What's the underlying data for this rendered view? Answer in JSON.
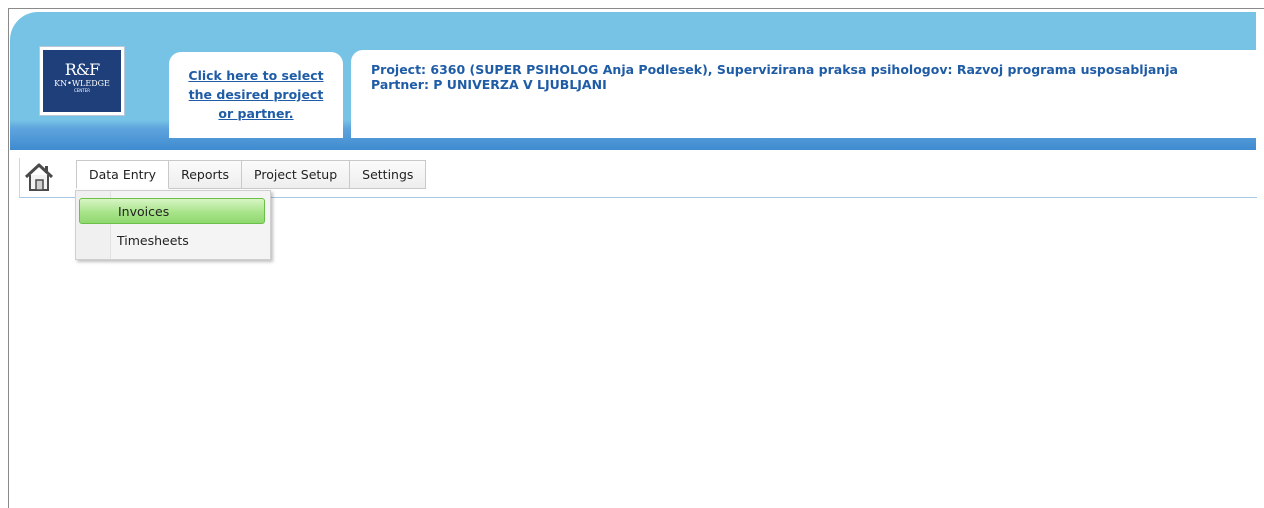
{
  "header": {
    "logo_text": "R&F KNOWLEDGE CENTER",
    "select_link_lines": [
      "Click here to select",
      "the desired project",
      "or partner."
    ],
    "project_line": "Project: 6360 (SUPER PSIHOLOG Anja Podlesek), Supervizirana praksa psihologov: Razvoj programa usposabljanja",
    "partner_line": "Partner: P UNIVERZA V LJUBLJANI"
  },
  "menu": {
    "home_icon": "home-icon",
    "items": [
      "Data Entry",
      "Reports",
      "Project Setup",
      "Settings"
    ],
    "active_index": 0
  },
  "dropdown": {
    "items": [
      "Invoices",
      "Timesheets"
    ],
    "highlighted_index": 0
  },
  "colors": {
    "header_top": "#76c3e6",
    "header_bottom": "#3f8bd0",
    "link_blue": "#1f5ca6",
    "highlight_green": "#a8e48a"
  }
}
